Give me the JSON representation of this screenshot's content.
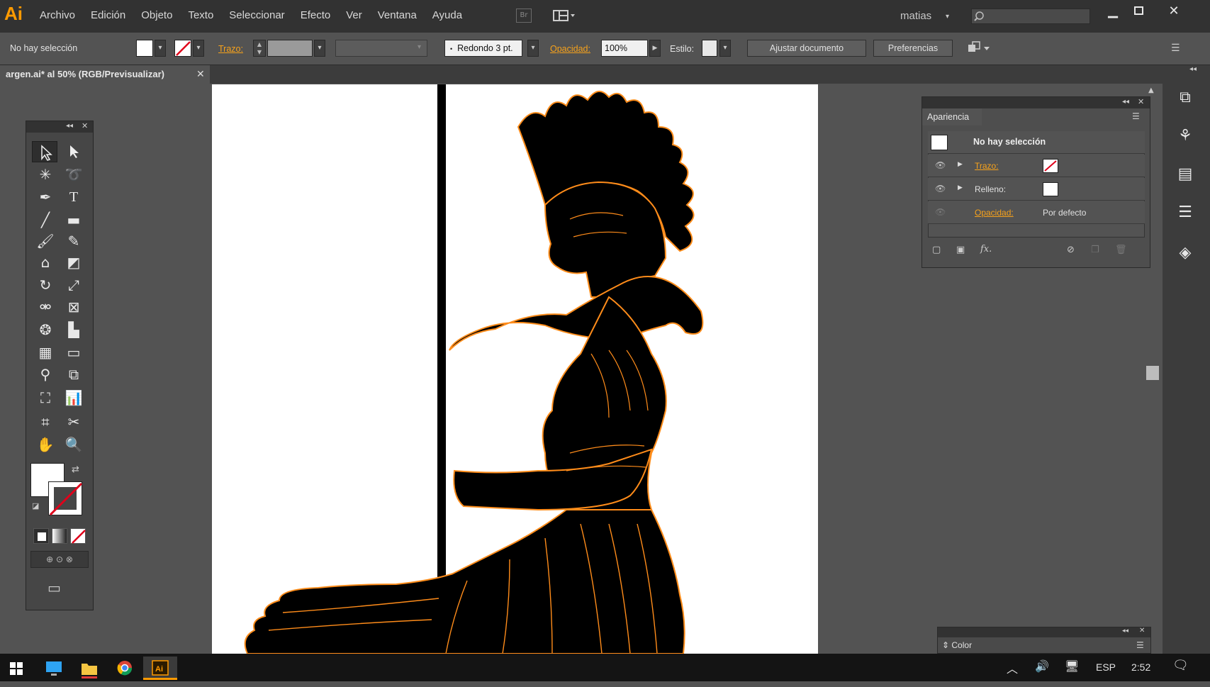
{
  "app": {
    "logo": "Ai",
    "user": "matias"
  },
  "menu": [
    "Archivo",
    "Edición",
    "Objeto",
    "Texto",
    "Seleccionar",
    "Efecto",
    "Ver",
    "Ventana",
    "Ayuda"
  ],
  "bridge_label": "Br",
  "control_bar": {
    "selection_status": "No hay selección",
    "stroke_label": "Trazo:",
    "brush_label": "Redondo 3 pt.",
    "opacity_label": "Opacidad:",
    "opacity_value": "100%",
    "style_label": "Estilo:",
    "fit_button": "Ajustar documento",
    "prefs_button": "Preferencias"
  },
  "document_tab": {
    "title": "argen.ai* al 50% (RGB/Previsualizar)"
  },
  "appearance_panel": {
    "title": "Apariencia",
    "header": "No hay selección",
    "rows": [
      {
        "label": "Trazo:"
      },
      {
        "label": "Relleno:"
      },
      {
        "label": "Opacidad:",
        "value": "Por defecto"
      }
    ]
  },
  "color_panel": {
    "title": "Color"
  },
  "taskbar": {
    "language": "ESP",
    "time": "2:52"
  },
  "colors": {
    "accent": "#f7a21b",
    "artwork_stroke": "#ff8c1a",
    "logo": "#ff9a00"
  }
}
